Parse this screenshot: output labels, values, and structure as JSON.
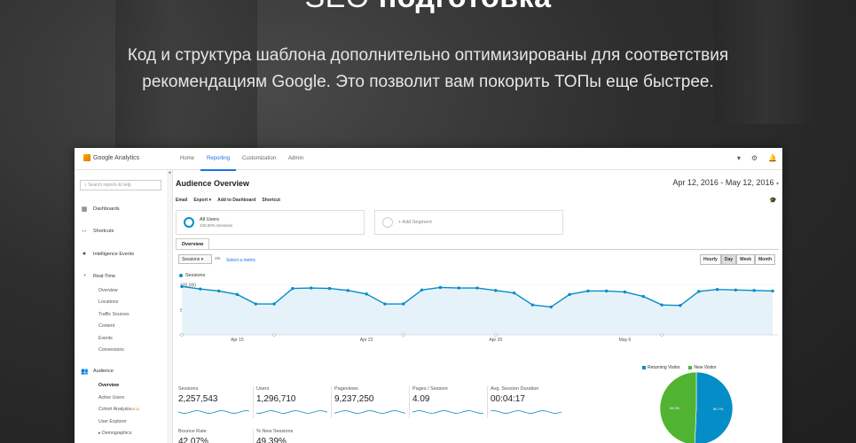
{
  "hero": {
    "title_light": "SEO ",
    "title_bold": "подготовка",
    "subtitle_line1": "Код и структура шаблона дополнительно оптимизированы для соответствия",
    "subtitle_line2": "рекомендациям Google. Это позволит вам покорить ТОПы еще быстрее."
  },
  "ga": {
    "brand": "Google Analytics",
    "nav": [
      "Home",
      "Reporting",
      "Customization",
      "Admin"
    ],
    "active_nav": "Reporting",
    "search_placeholder": "Search reports & help",
    "sidebar": {
      "dashboards": "Dashboards",
      "shortcuts": "Shortcuts",
      "intelligence": "Intelligence Events",
      "realtime": "Real-Time",
      "realtime_items": [
        "Overview",
        "Locations",
        "Traffic Sources",
        "Content",
        "Events",
        "Conversions"
      ],
      "audience": "Audience",
      "audience_items": [
        "Overview",
        "Active Users",
        "Cohort Analysis",
        "User Explorer",
        "▸ Demographics"
      ],
      "beta": "BETA"
    },
    "title": "Audience Overview",
    "date_range": "Apr 12, 2016 - May 12, 2016",
    "toolbar": [
      "Email",
      "Export ▾",
      "Add to Dashboard",
      "Shortcut"
    ],
    "segment_all": "All Users",
    "segment_all_sub": "100.00% Sessions",
    "segment_add": "+ Add Segment",
    "tab": "Overview",
    "metric": "Sessions ▾",
    "vs": "VS.",
    "select_metric": "Select a metric",
    "granularity": [
      "Hourly",
      "Day",
      "Week",
      "Month"
    ],
    "granularity_active": "Day",
    "legend": "Sessions",
    "y_ticks": [
      "100,000",
      "50,000"
    ],
    "x_ticks": [
      "Apr 15",
      "Apr 22",
      "Apr 29",
      "May 6"
    ],
    "kpis": [
      {
        "label": "Sessions",
        "value": "2,257,543"
      },
      {
        "label": "Users",
        "value": "1,296,710"
      },
      {
        "label": "Pageviews",
        "value": "9,237,250"
      },
      {
        "label": "Pages / Session",
        "value": "4.09"
      },
      {
        "label": "Avg. Session Duration",
        "value": "00:04:17"
      },
      {
        "label": "Bounce Rate",
        "value": "42.07%"
      },
      {
        "label": "% New Sessions",
        "value": "49.39%"
      }
    ],
    "pie": {
      "legend": [
        "Returning Visitor",
        "New Visitor"
      ],
      "values": [
        50.7,
        49.3
      ],
      "labels": [
        "50.7%",
        "49.3%"
      ],
      "colors": [
        "#058dc7",
        "#50b432"
      ]
    },
    "colors": {
      "accent": "#1a73e8",
      "series": "#058dc7"
    }
  },
  "chart_data": {
    "type": "area",
    "series": [
      {
        "name": "Sessions",
        "values": [
          97000,
          92000,
          88000,
          81000,
          62000,
          62000,
          93000,
          94000,
          93000,
          89000,
          82000,
          62000,
          62000,
          90000,
          95000,
          94000,
          94000,
          89000,
          84000,
          60000,
          56000,
          81000,
          88000,
          88000,
          86000,
          77000,
          60000,
          59000,
          87000,
          91000,
          90000,
          89000,
          88000
        ]
      }
    ],
    "xlabel": "",
    "ylabel": "",
    "ylim": [
      0,
      110000
    ]
  }
}
